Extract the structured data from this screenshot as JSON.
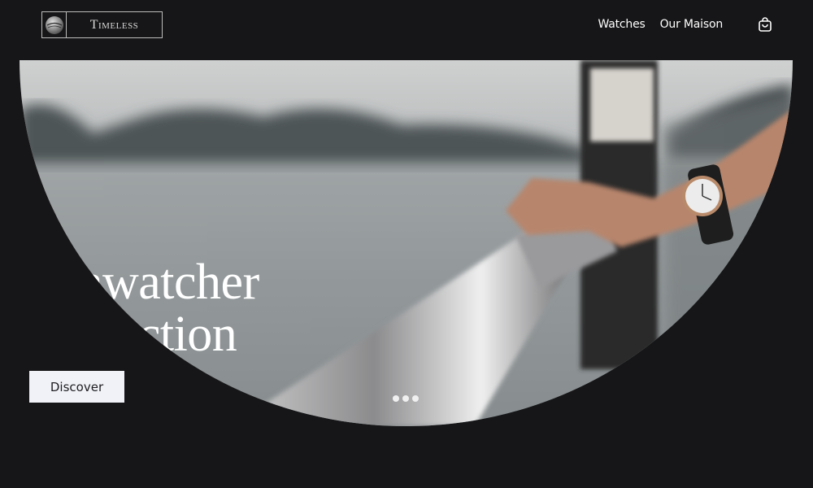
{
  "brand": {
    "logo_text": "Timeless"
  },
  "nav": {
    "items": [
      {
        "label": "Watches"
      },
      {
        "label": "Our Maison"
      }
    ],
    "cart_icon": "shopping-bag-icon"
  },
  "hero": {
    "title_line1": "Seawatcher",
    "title_line2": "Collection",
    "cta_label": "Discover",
    "slide_count": 3,
    "active_slide": 1
  },
  "colors": {
    "background": "#161618",
    "button_bg": "#f1f2f7",
    "text": "#ffffff"
  }
}
